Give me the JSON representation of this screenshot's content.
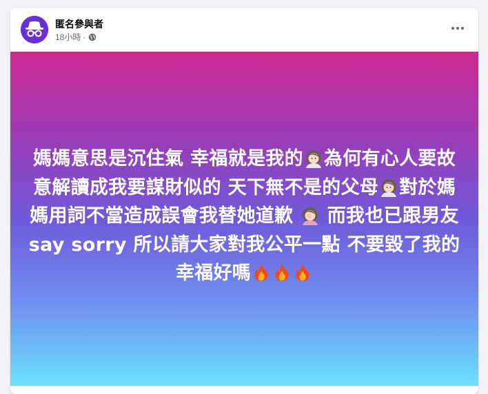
{
  "post": {
    "author": "匿名參與者",
    "time": "18小時",
    "separator": "·",
    "privacy_icon": "globe-icon",
    "more_icon": "more-options-icon",
    "avatar_icon": "incognito-icon",
    "background_gradient": [
      "#cf2a92",
      "#6f59d8",
      "#6ee0fb"
    ],
    "text_segments": [
      "媽媽意思是沉住氣 幸福就是我的",
      "為何有心人要故意解讀成我要謀財似的 天下無不是的父母",
      "對於媽媽用詞不當造成誤會我替她道歉 ",
      " 而我也已跟男友say sorry 所以請大家對我公平一點 不要毀了我的幸福好嗎"
    ],
    "emojis": [
      "woman-icon",
      "woman-icon",
      "woman-facepalming-icon",
      "fire-icon",
      "fire-icon",
      "fire-icon"
    ]
  }
}
